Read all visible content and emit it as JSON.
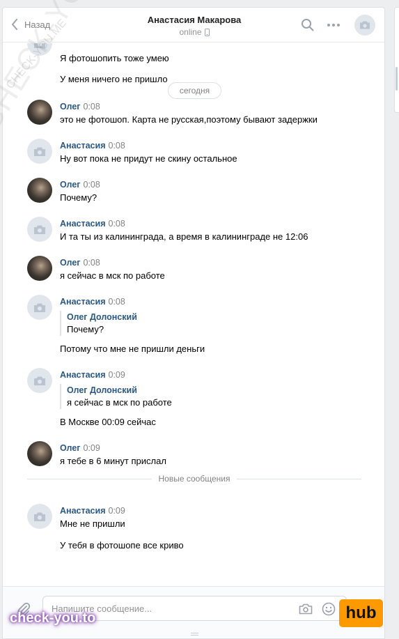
{
  "header": {
    "back_label": "Назад",
    "title": "Анастасия Макарова",
    "status": "online"
  },
  "history": {
    "date_pill": "сегодня",
    "messages": [
      {
        "author": "",
        "time": "",
        "lines": [
          "Я фотошопить тоже умею",
          "У меня ничего не пришло"
        ]
      },
      {
        "author": "Олег",
        "time": "0:08",
        "lines": [
          "это не фотошоп. Карта не русская,поэтому бывают задержки"
        ]
      },
      {
        "author": "Анастасия",
        "time": "0:08",
        "lines": [
          "Ну вот пока не придут не скину остальное"
        ]
      },
      {
        "author": "Олег",
        "time": "0:08",
        "lines": [
          "Почему?"
        ]
      },
      {
        "author": "Анастасия",
        "time": "0:08",
        "lines": [
          "И та ты из калининграда, а время в калининграде не 12:06"
        ]
      },
      {
        "author": "Олег",
        "time": "0:08",
        "lines": [
          "я сейчас в мск по работе"
        ]
      },
      {
        "author": "Анастасия",
        "time": "0:08",
        "quote": {
          "author": "Олег Долонский",
          "text": "Почему?"
        },
        "lines": [
          "Потому что мне не пришли деньги"
        ]
      },
      {
        "author": "Анастасия",
        "time": "0:09",
        "quote": {
          "author": "Олег Долонский",
          "text": "я сейчас в мск по работе"
        },
        "lines": [
          "В Москве 00:09 сейчас"
        ]
      },
      {
        "author": "Олег",
        "time": "0:09",
        "lines": [
          "я тебе в 6 минут прислал"
        ]
      },
      {
        "author": "Анастасия",
        "time": "0:09",
        "lines": [
          "Мне не пришли",
          "У тебя в фотошопе все криво"
        ]
      }
    ],
    "new_messages_label": "Новые сообщения"
  },
  "composer": {
    "placeholder": "Напишите сообщение..."
  },
  "watermarks": {
    "diagonal": "CHECK-YOU.ME",
    "small": "CHECK-YOU.ME",
    "bottom": "check-you.to",
    "badge": "hub"
  },
  "colors": {
    "accent": "#2a5885",
    "background": "#edeef0",
    "badge": "#ff9900"
  }
}
